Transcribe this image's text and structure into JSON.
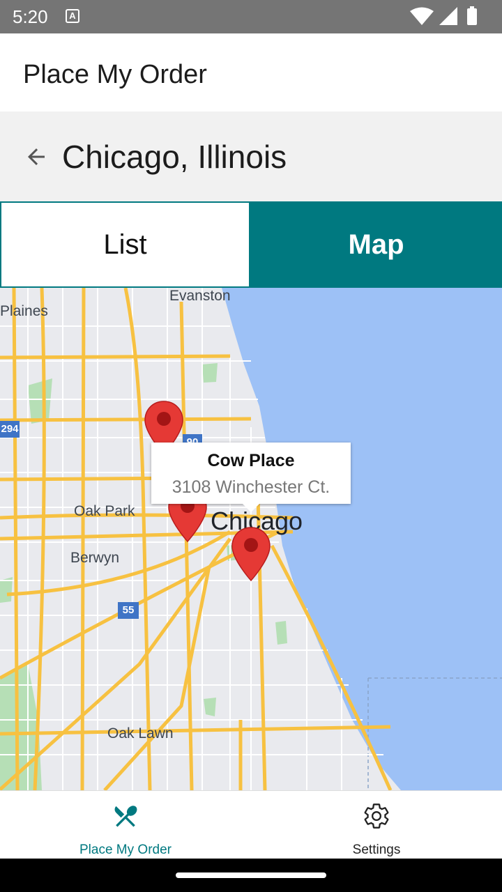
{
  "status_bar": {
    "time": "5:20",
    "notification_glyph": "A"
  },
  "app_bar": {
    "title": "Place My Order"
  },
  "city_header": {
    "city": "Chicago, Illinois"
  },
  "tabs": [
    {
      "label": "List",
      "selected": false
    },
    {
      "label": "Map",
      "selected": true
    }
  ],
  "map": {
    "labels": {
      "evanston": "Evanston",
      "des_plaines": "Plaines",
      "oak_park": "Oak Park",
      "chicago": "Chicago",
      "berwyn": "Berwyn",
      "oak_lawn": "Oak Lawn"
    },
    "shields": {
      "i294": "294",
      "i90": "90",
      "i55": "55"
    },
    "callout": {
      "name": "Cow Place",
      "address": "3108 Winchester Ct."
    },
    "colors": {
      "water": "#9dc1f6",
      "land": "#e9eaee",
      "highway": "#f7c141",
      "park": "#b6dfb6",
      "pin": "#e53935"
    }
  },
  "bottom_nav": {
    "items": [
      {
        "label": "Place My Order",
        "icon": "fork-knife-icon",
        "active": true
      },
      {
        "label": "Settings",
        "icon": "gear-icon",
        "active": false
      }
    ]
  },
  "colors": {
    "accent": "#007980",
    "status_bar": "#757575"
  }
}
